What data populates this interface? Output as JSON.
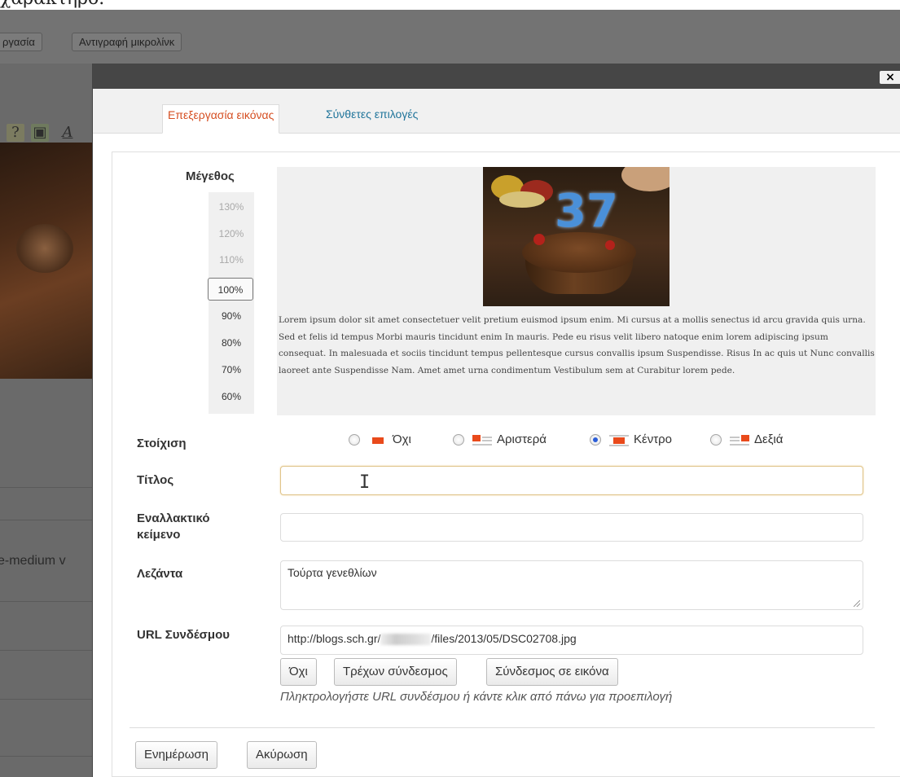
{
  "page": {
    "top_heading_fragment": "χαρακτηρο."
  },
  "background": {
    "toolbar_buttons": [
      "ργασία",
      "Αντιγραφή μικρολίνκ"
    ],
    "side_label": "e-medium v"
  },
  "dialog": {
    "close_label": "×",
    "tabs": [
      {
        "label": "Επεξεργασία εικόνας",
        "active": true
      },
      {
        "label": "Σύνθετες επιλογές",
        "active": false
      }
    ],
    "size": {
      "title": "Μέγεθος",
      "options": [
        "130%",
        "120%",
        "110%",
        "100%",
        "90%",
        "80%",
        "70%",
        "60%"
      ],
      "selected": "100%"
    },
    "preview": {
      "image_alt": "Τούρτα γενεθλίων",
      "candle_text": "37",
      "text": "Lorem ipsum dolor sit amet consectetuer velit pretium euismod ipsum enim. Mi cursus at a mollis senectus id arcu gravida quis urna. Sed et felis id tempus Morbi mauris tincidunt enim In mauris. Pede eu risus velit libero natoque enim lorem adipiscing ipsum consequat. In malesuada et sociis tincidunt tempus pellentesque cursus convallis ipsum Suspendisse. Risus In ac quis ut Nunc convallis laoreet ante Suspendisse Nam. Amet amet urna condimentum Vestibulum sem at Curabitur lorem pede."
    },
    "alignment": {
      "label": "Στοίχιση",
      "options": [
        "Όχι",
        "Αριστερά",
        "Κέντρο",
        "Δεξιά"
      ],
      "selected": "Κέντρο"
    },
    "title_field": {
      "label": "Τίτλος",
      "value": ""
    },
    "alt_field": {
      "label_line1": "Εναλλακτικό",
      "label_line2": "κείμενο",
      "value": ""
    },
    "caption_field": {
      "label": "Λεζάντα",
      "value": "Τούρτα γενεθλίων"
    },
    "link_field": {
      "label": "URL Συνδέσμου",
      "value_prefix": "http://blogs.sch.gr/",
      "value_suffix": "/files/2013/05/DSC02708.jpg",
      "buttons": [
        "Όχι",
        "Τρέχων σύνδεσμος",
        "Σύνδεσμος σε εικόνα"
      ],
      "hint": "Πληκτρολογήστε URL συνδέσμου ή κάντε κλικ από πάνω για προεπιλογή"
    },
    "actions": {
      "update": "Ενημέρωση",
      "cancel": "Ακύρωση"
    },
    "colors": {
      "active_tab": "#d54e21",
      "inactive_tab": "#21759b",
      "titlebar": "#464646"
    }
  }
}
